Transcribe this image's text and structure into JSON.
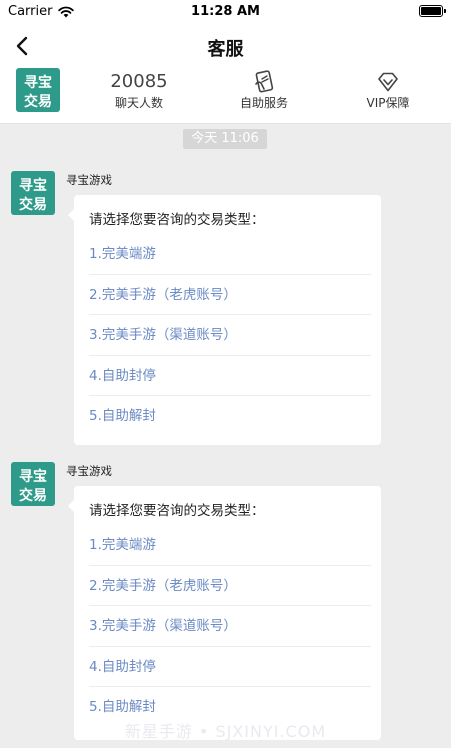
{
  "status_bar": {
    "carrier": "Carrier",
    "time": "11:28 AM",
    "battery_level": 1.0
  },
  "nav": {
    "title": "客服"
  },
  "brand": {
    "logo_text_line1": "寻宝",
    "logo_text_line2": "交易",
    "logo_color": "#2e9a8a"
  },
  "info": {
    "chat_count": "20085",
    "chat_label": "聊天人数",
    "self_service_label": "自助服务",
    "vip_label": "VIP保障"
  },
  "timestamp": "今天 11:06",
  "messages": [
    {
      "sender": "寻宝游戏",
      "prompt": "请选择您要咨询的交易类型：",
      "options": [
        "1.完美端游",
        "2.完美手游（老虎账号）",
        "3.完美手游（渠道账号）",
        "4.自助封停",
        "5.自助解封"
      ]
    },
    {
      "sender": "寻宝游戏",
      "prompt": "请选择您要咨询的交易类型：",
      "options": [
        "1.完美端游",
        "2.完美手游（老虎账号）",
        "3.完美手游（渠道账号）",
        "4.自助封停",
        "5.自助解封"
      ]
    }
  ],
  "watermark": "新星手游 • SJXINYI.COM",
  "colors": {
    "link": "#6a8ac4",
    "background": "#ededed",
    "bubble": "#ffffff",
    "teal": "#2e9a8a"
  }
}
